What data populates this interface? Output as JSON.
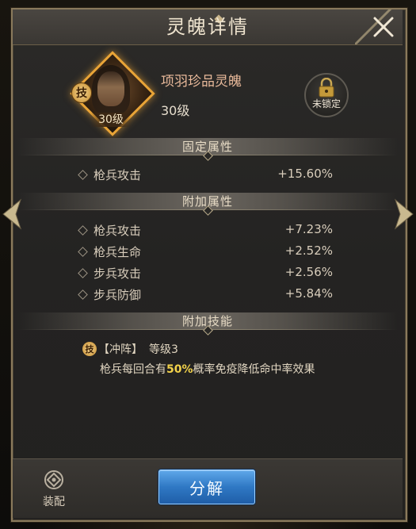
{
  "title": "灵魄详情",
  "soul": {
    "name": "项羽珍品灵魄",
    "level": "30级",
    "portrait_level": "30级",
    "skill_badge": "技"
  },
  "lock": {
    "label": "未锁定"
  },
  "fixed_section": {
    "header": "固定属性",
    "stats": [
      {
        "name": "枪兵攻击",
        "value": "+15.60%"
      }
    ]
  },
  "extra_section": {
    "header": "附加属性",
    "stats": [
      {
        "name": "枪兵攻击",
        "value": "+7.23%"
      },
      {
        "name": "枪兵生命",
        "value": "+2.52%"
      },
      {
        "name": "步兵攻击",
        "value": "+2.56%"
      },
      {
        "name": "步兵防御",
        "value": "+5.84%"
      }
    ]
  },
  "skill_section": {
    "header": "附加技能",
    "badge": "技",
    "skill_name": "【冲阵】",
    "skill_level": "等级3",
    "desc_prefix": "枪兵每回合有",
    "desc_highlight": "50%",
    "desc_suffix": "概率免疫降低命中率效果"
  },
  "footer": {
    "equip_label": "装配",
    "decompose_label": "分解"
  },
  "colors": {
    "accent_gold": "#e9a437",
    "name_color": "#e8b99a",
    "highlight": "#f2d24a",
    "button_blue": "#2f78c4"
  },
  "icons": {
    "close": "close-icon",
    "lock": "padlock-icon",
    "prev": "arrow-left-icon",
    "next": "arrow-right-icon",
    "equip": "equip-slot-icon"
  }
}
